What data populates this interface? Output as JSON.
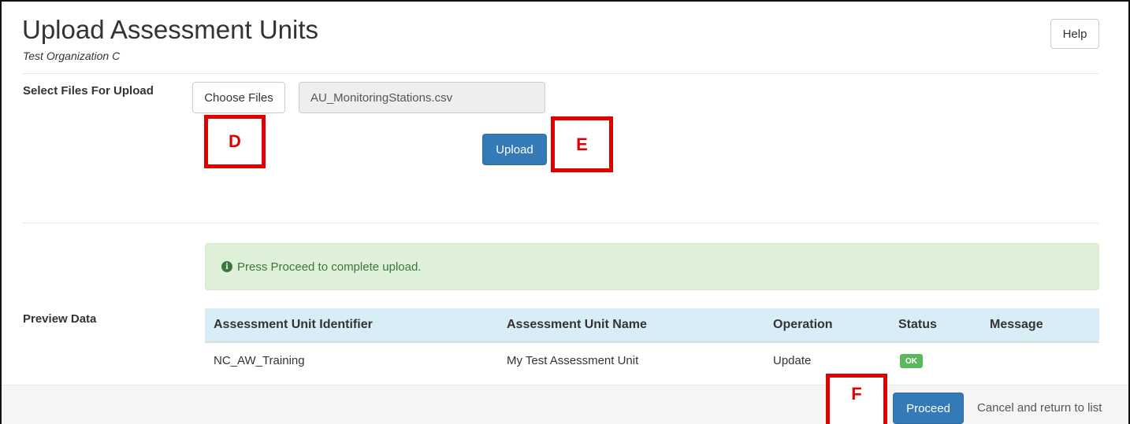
{
  "header": {
    "title": "Upload Assessment Units",
    "subtitle": "Test Organization C",
    "help_label": "Help"
  },
  "upload_section": {
    "label": "Select Files For Upload",
    "choose_files_label": "Choose Files",
    "selected_file": "AU_MonitoringStations.csv",
    "upload_label": "Upload"
  },
  "callouts": {
    "d": "D",
    "e": "E",
    "f": "F"
  },
  "preview": {
    "label": "Preview Data",
    "alert_text": "Press Proceed to complete upload.",
    "columns": [
      "Assessment Unit Identifier",
      "Assessment Unit Name",
      "Operation",
      "Status",
      "Message"
    ],
    "rows": [
      {
        "identifier": "NC_AW_Training",
        "name": "My Test Assessment Unit",
        "operation": "Update",
        "status": "OK",
        "message": ""
      }
    ]
  },
  "footer": {
    "proceed_label": "Proceed",
    "cancel_label": "Cancel and return to list"
  },
  "colors": {
    "primary": "#337ab7",
    "success_bg": "#dff0d8",
    "table_header_bg": "#d9edf7",
    "callout": "#e00000"
  }
}
